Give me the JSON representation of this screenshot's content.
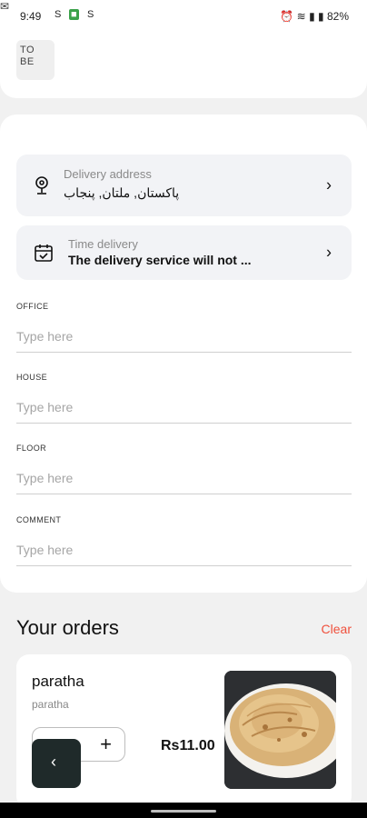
{
  "status_bar": {
    "time": "9:49",
    "icons_left": [
      "S",
      "S"
    ],
    "battery": "82%"
  },
  "logo": {
    "line1": "TO",
    "line2": "BE"
  },
  "delivery_address": {
    "label": "Delivery address",
    "value": "پاکستان, ملتان, پنجاب"
  },
  "time_delivery": {
    "label": "Time delivery",
    "value": "The delivery service will not ..."
  },
  "fields": [
    {
      "label": "OFFICE",
      "placeholder": "Type here"
    },
    {
      "label": "HOUSE",
      "placeholder": "Type here"
    },
    {
      "label": "FLOOR",
      "placeholder": "Type here"
    },
    {
      "label": "COMMENT",
      "placeholder": "Type here"
    }
  ],
  "orders": {
    "title": "Your orders",
    "clear_label": "Clear",
    "items": [
      {
        "name": "paratha",
        "subtitle": "paratha",
        "price": "Rs11.00"
      }
    ]
  },
  "icons": {
    "location": "location-pin-icon",
    "calendar": "calendar-check-icon",
    "chevron": "chevron-right-icon",
    "plus": "plus-icon",
    "back": "chevron-left-icon"
  },
  "colors": {
    "accent": "#f0503c",
    "fab": "#1f2a2a"
  }
}
